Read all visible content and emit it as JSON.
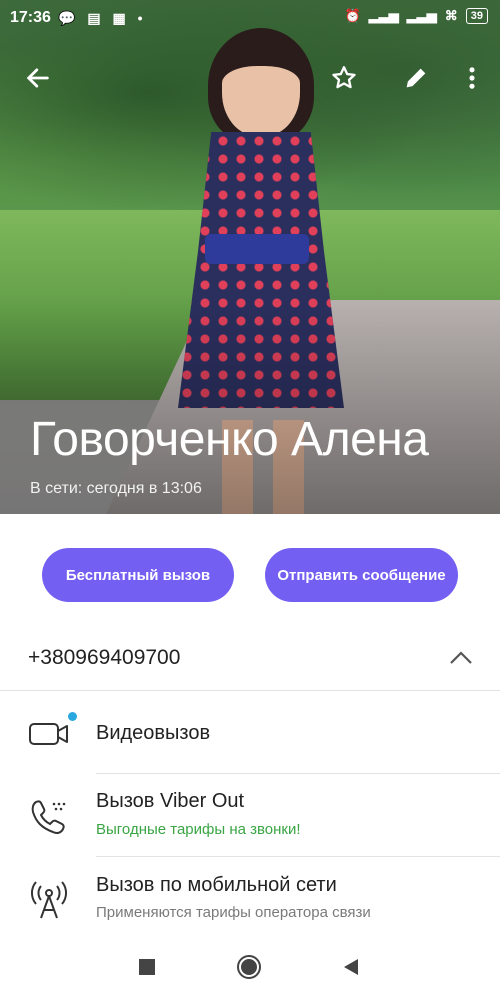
{
  "status_bar": {
    "time": "17:36",
    "left_icons": [
      "chat-bubble-icon",
      "message-icon",
      "qr-icon",
      "dot-icon"
    ],
    "right_icons": [
      "alarm-icon",
      "signal-icon",
      "signal-icon",
      "wifi-icon"
    ],
    "battery": "39"
  },
  "header": {
    "contact_name": "Говорченко Алена",
    "presence": "В сети: сегодня в 13:06",
    "icons": [
      "back-arrow-icon",
      "star-icon",
      "pencil-icon",
      "more-vert-icon"
    ],
    "text_color": "#ffffff"
  },
  "actions": {
    "free_call_label": "Бесплатный вызов",
    "send_message_label": "Отправить сообщение",
    "accent_color": "#7360f2"
  },
  "phone": {
    "number": "+380969409700",
    "expanded": true
  },
  "call_options": [
    {
      "icon": "video-camera-icon",
      "title": "Видеовызов",
      "subtitle": ""
    },
    {
      "icon": "viber-out-phone-icon",
      "title": "Вызов Viber Out",
      "subtitle": "Выгодные тарифы на звонки!",
      "subtitle_color": "#3aa544"
    },
    {
      "icon": "antenna-icon",
      "title": "Вызов по мобильной сети",
      "subtitle": "Применяются тарифы оператора связи",
      "subtitle_color": "#7a7a7a"
    }
  ],
  "nav_bar": {
    "icons": [
      "recents-square-icon",
      "home-circle-icon",
      "back-triangle-icon"
    ]
  }
}
